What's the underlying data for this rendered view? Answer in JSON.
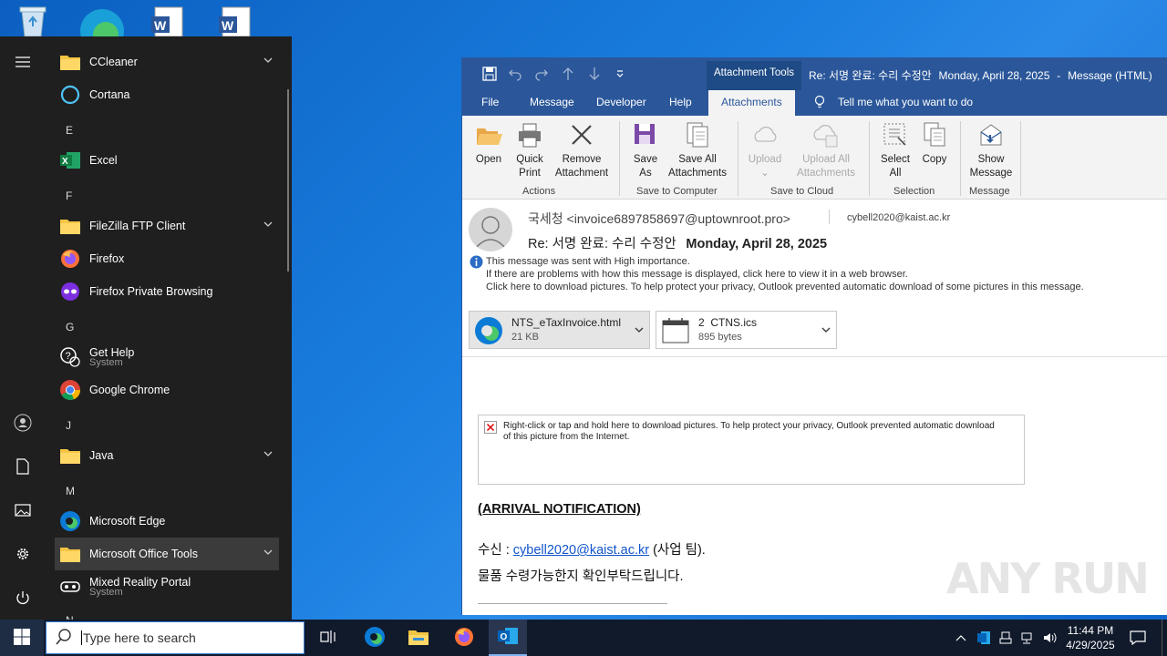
{
  "start_menu": {
    "apps": [
      {
        "name": "CCleaner",
        "type": "folder",
        "expand": true
      },
      {
        "name": "Cortana",
        "type": "app"
      },
      {
        "letter": "E"
      },
      {
        "name": "Excel",
        "type": "app"
      },
      {
        "letter": "F"
      },
      {
        "name": "FileZilla FTP Client",
        "type": "folder",
        "expand": true
      },
      {
        "name": "Firefox",
        "type": "app"
      },
      {
        "name": "Firefox Private Browsing",
        "type": "app"
      },
      {
        "letter": "G"
      },
      {
        "name": "Get Help",
        "sub": "System",
        "type": "app"
      },
      {
        "name": "Google Chrome",
        "type": "app"
      },
      {
        "letter": "J"
      },
      {
        "name": "Java",
        "type": "folder",
        "expand": true
      },
      {
        "letter": "M"
      },
      {
        "name": "Microsoft Edge",
        "type": "app"
      },
      {
        "name": "Microsoft Office Tools",
        "type": "folder",
        "expand": true,
        "selected": true
      },
      {
        "name": "Mixed Reality Portal",
        "sub": "System",
        "type": "app"
      },
      {
        "letter": "N"
      }
    ]
  },
  "outlook": {
    "title": {
      "context_tab": "Attachment Tools",
      "subject": "Re: 서명 완료: 수리 수정안",
      "date": "Monday, April 28, 2025",
      "dash": "-",
      "kind": "Message (HTML)"
    },
    "tabs": [
      "File",
      "Message",
      "Developer",
      "Help",
      "Attachments"
    ],
    "tell_me": "Tell me what you want to do",
    "ribbon": {
      "open": "Open",
      "quick_print_1": "Quick",
      "quick_print_2": "Print",
      "remove_1": "Remove",
      "remove_2": "Attachment",
      "group_actions": "Actions",
      "save_as_1": "Save",
      "save_as_2": "As",
      "save_all_1": "Save All",
      "save_all_2": "Attachments",
      "group_save": "Save to Computer",
      "upload": "Upload",
      "upload_all_1": "Upload All",
      "upload_all_2": "Attachments",
      "group_cloud": "Save to Cloud",
      "select_all_1": "Select",
      "select_all_2": "All",
      "copy": "Copy",
      "group_selection": "Selection",
      "show_msg_1": "Show",
      "show_msg_2": "Message",
      "group_message": "Message"
    },
    "header": {
      "from": "국세청 <invoice6897858697@uptownroot.pro>",
      "to": "cybell2020@kaist.ac.kr",
      "subject": "Re: 서명 완료: 수리 수정안",
      "date": "Monday, April 28, 2025",
      "info1": "This message was sent with High importance.",
      "info2": "If there are problems with how this message is displayed, click here to view it in a web browser.",
      "info3": "Click here to download pictures. To help protect your privacy, Outlook prevented automatic download of some pictures in this message."
    },
    "attachments": [
      {
        "name": "NTS_eTaxInvoice.html",
        "size": "21 KB"
      },
      {
        "name": "2  CTNS.ics",
        "size": "895 bytes"
      }
    ],
    "body": {
      "blocked_1": "Right-click or tap and hold here to download pictures. To help protect your privacy, Outlook prevented automatic download",
      "blocked_2": "of this picture from the Internet.",
      "heading": "(ARRIVAL NOTIFICATION)",
      "recipient_label": "수신 : ",
      "recipient_link": "cybell2020@kaist.ac.kr",
      "recipient_suffix": " (사업 팀).",
      "line2": "물품 수령가능한지 확인부탁드립니다."
    }
  },
  "taskbar": {
    "search_placeholder": "Type here to search",
    "time": "11:44 PM",
    "date": "4/29/2025"
  },
  "watermark": "ANY RUN"
}
